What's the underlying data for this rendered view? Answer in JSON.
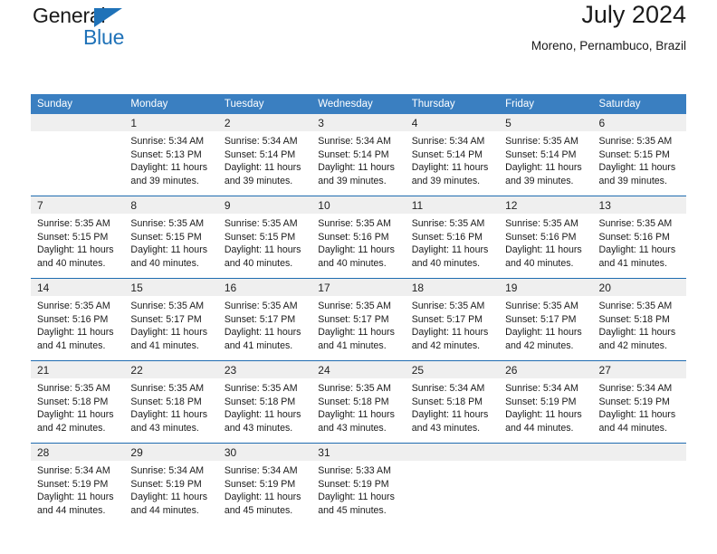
{
  "brand": {
    "name_part1": "General",
    "name_part2": "Blue",
    "triangle_color": "#1f72b8"
  },
  "header": {
    "title": "July 2024",
    "subtitle": "Moreno, Pernambuco, Brazil"
  },
  "theme": {
    "header_bg": "#3a7fc1",
    "row_divider": "#1f6cb0",
    "daynum_band": "#efefef"
  },
  "weekdays": [
    "Sunday",
    "Monday",
    "Tuesday",
    "Wednesday",
    "Thursday",
    "Friday",
    "Saturday"
  ],
  "weeks": [
    [
      {
        "day": "",
        "sunrise": "",
        "sunset": "",
        "daylight": "",
        "empty": true
      },
      {
        "day": "1",
        "sunrise": "Sunrise: 5:34 AM",
        "sunset": "Sunset: 5:13 PM",
        "daylight": "Daylight: 11 hours and 39 minutes."
      },
      {
        "day": "2",
        "sunrise": "Sunrise: 5:34 AM",
        "sunset": "Sunset: 5:14 PM",
        "daylight": "Daylight: 11 hours and 39 minutes."
      },
      {
        "day": "3",
        "sunrise": "Sunrise: 5:34 AM",
        "sunset": "Sunset: 5:14 PM",
        "daylight": "Daylight: 11 hours and 39 minutes."
      },
      {
        "day": "4",
        "sunrise": "Sunrise: 5:34 AM",
        "sunset": "Sunset: 5:14 PM",
        "daylight": "Daylight: 11 hours and 39 minutes."
      },
      {
        "day": "5",
        "sunrise": "Sunrise: 5:35 AM",
        "sunset": "Sunset: 5:14 PM",
        "daylight": "Daylight: 11 hours and 39 minutes."
      },
      {
        "day": "6",
        "sunrise": "Sunrise: 5:35 AM",
        "sunset": "Sunset: 5:15 PM",
        "daylight": "Daylight: 11 hours and 39 minutes."
      }
    ],
    [
      {
        "day": "7",
        "sunrise": "Sunrise: 5:35 AM",
        "sunset": "Sunset: 5:15 PM",
        "daylight": "Daylight: 11 hours and 40 minutes."
      },
      {
        "day": "8",
        "sunrise": "Sunrise: 5:35 AM",
        "sunset": "Sunset: 5:15 PM",
        "daylight": "Daylight: 11 hours and 40 minutes."
      },
      {
        "day": "9",
        "sunrise": "Sunrise: 5:35 AM",
        "sunset": "Sunset: 5:15 PM",
        "daylight": "Daylight: 11 hours and 40 minutes."
      },
      {
        "day": "10",
        "sunrise": "Sunrise: 5:35 AM",
        "sunset": "Sunset: 5:16 PM",
        "daylight": "Daylight: 11 hours and 40 minutes."
      },
      {
        "day": "11",
        "sunrise": "Sunrise: 5:35 AM",
        "sunset": "Sunset: 5:16 PM",
        "daylight": "Daylight: 11 hours and 40 minutes."
      },
      {
        "day": "12",
        "sunrise": "Sunrise: 5:35 AM",
        "sunset": "Sunset: 5:16 PM",
        "daylight": "Daylight: 11 hours and 40 minutes."
      },
      {
        "day": "13",
        "sunrise": "Sunrise: 5:35 AM",
        "sunset": "Sunset: 5:16 PM",
        "daylight": "Daylight: 11 hours and 41 minutes."
      }
    ],
    [
      {
        "day": "14",
        "sunrise": "Sunrise: 5:35 AM",
        "sunset": "Sunset: 5:16 PM",
        "daylight": "Daylight: 11 hours and 41 minutes."
      },
      {
        "day": "15",
        "sunrise": "Sunrise: 5:35 AM",
        "sunset": "Sunset: 5:17 PM",
        "daylight": "Daylight: 11 hours and 41 minutes."
      },
      {
        "day": "16",
        "sunrise": "Sunrise: 5:35 AM",
        "sunset": "Sunset: 5:17 PM",
        "daylight": "Daylight: 11 hours and 41 minutes."
      },
      {
        "day": "17",
        "sunrise": "Sunrise: 5:35 AM",
        "sunset": "Sunset: 5:17 PM",
        "daylight": "Daylight: 11 hours and 41 minutes."
      },
      {
        "day": "18",
        "sunrise": "Sunrise: 5:35 AM",
        "sunset": "Sunset: 5:17 PM",
        "daylight": "Daylight: 11 hours and 42 minutes."
      },
      {
        "day": "19",
        "sunrise": "Sunrise: 5:35 AM",
        "sunset": "Sunset: 5:17 PM",
        "daylight": "Daylight: 11 hours and 42 minutes."
      },
      {
        "day": "20",
        "sunrise": "Sunrise: 5:35 AM",
        "sunset": "Sunset: 5:18 PM",
        "daylight": "Daylight: 11 hours and 42 minutes."
      }
    ],
    [
      {
        "day": "21",
        "sunrise": "Sunrise: 5:35 AM",
        "sunset": "Sunset: 5:18 PM",
        "daylight": "Daylight: 11 hours and 42 minutes."
      },
      {
        "day": "22",
        "sunrise": "Sunrise: 5:35 AM",
        "sunset": "Sunset: 5:18 PM",
        "daylight": "Daylight: 11 hours and 43 minutes."
      },
      {
        "day": "23",
        "sunrise": "Sunrise: 5:35 AM",
        "sunset": "Sunset: 5:18 PM",
        "daylight": "Daylight: 11 hours and 43 minutes."
      },
      {
        "day": "24",
        "sunrise": "Sunrise: 5:35 AM",
        "sunset": "Sunset: 5:18 PM",
        "daylight": "Daylight: 11 hours and 43 minutes."
      },
      {
        "day": "25",
        "sunrise": "Sunrise: 5:34 AM",
        "sunset": "Sunset: 5:18 PM",
        "daylight": "Daylight: 11 hours and 43 minutes."
      },
      {
        "day": "26",
        "sunrise": "Sunrise: 5:34 AM",
        "sunset": "Sunset: 5:19 PM",
        "daylight": "Daylight: 11 hours and 44 minutes."
      },
      {
        "day": "27",
        "sunrise": "Sunrise: 5:34 AM",
        "sunset": "Sunset: 5:19 PM",
        "daylight": "Daylight: 11 hours and 44 minutes."
      }
    ],
    [
      {
        "day": "28",
        "sunrise": "Sunrise: 5:34 AM",
        "sunset": "Sunset: 5:19 PM",
        "daylight": "Daylight: 11 hours and 44 minutes."
      },
      {
        "day": "29",
        "sunrise": "Sunrise: 5:34 AM",
        "sunset": "Sunset: 5:19 PM",
        "daylight": "Daylight: 11 hours and 44 minutes."
      },
      {
        "day": "30",
        "sunrise": "Sunrise: 5:34 AM",
        "sunset": "Sunset: 5:19 PM",
        "daylight": "Daylight: 11 hours and 45 minutes."
      },
      {
        "day": "31",
        "sunrise": "Sunrise: 5:33 AM",
        "sunset": "Sunset: 5:19 PM",
        "daylight": "Daylight: 11 hours and 45 minutes."
      },
      {
        "day": "",
        "sunrise": "",
        "sunset": "",
        "daylight": "",
        "empty": true
      },
      {
        "day": "",
        "sunrise": "",
        "sunset": "",
        "daylight": "",
        "empty": true
      },
      {
        "day": "",
        "sunrise": "",
        "sunset": "",
        "daylight": "",
        "empty": true
      }
    ]
  ]
}
